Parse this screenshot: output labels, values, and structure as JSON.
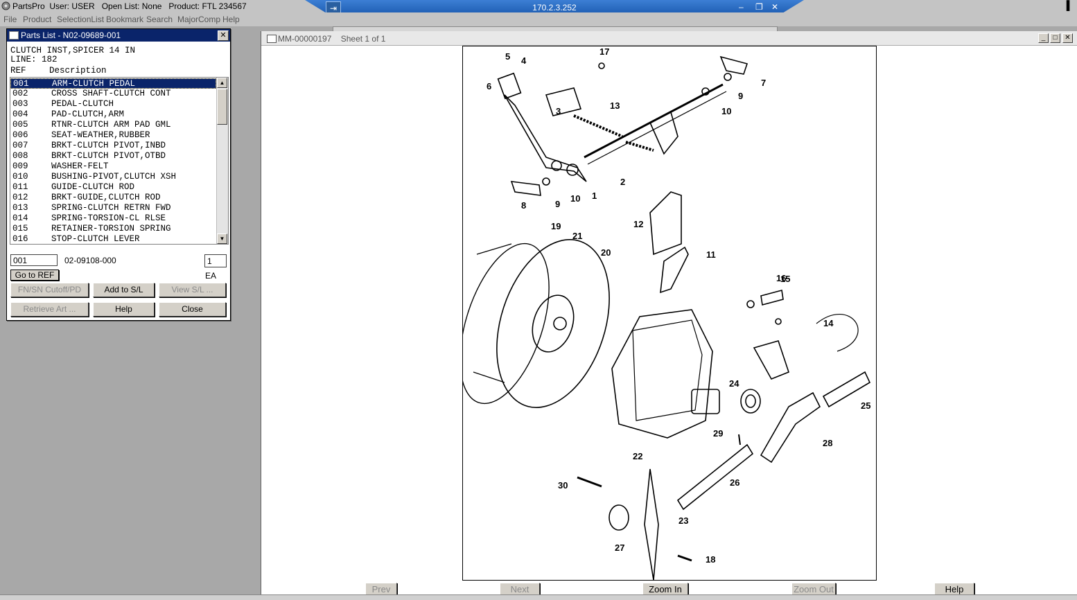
{
  "app": {
    "title": "PartsPro  User: USER   Open List: None   Product: FTL 234567",
    "remote_ip": "170.2.3.252"
  },
  "menu": [
    "File",
    "Product",
    "SelectionList",
    "Bookmark",
    "Search",
    "MajorComp",
    "Help"
  ],
  "parts_dialog": {
    "title": "Parts List - N02-09689-001",
    "description": "CLUTCH INST,SPICER 14 IN",
    "line": "LINE:  182",
    "col_ref": "REF",
    "col_desc": "Description",
    "rows": [
      {
        "ref": "001",
        "desc": "ARM-CLUTCH PEDAL",
        "selected": true
      },
      {
        "ref": "002",
        "desc": "CROSS SHAFT-CLUTCH CONT"
      },
      {
        "ref": "003",
        "desc": "PEDAL-CLUTCH"
      },
      {
        "ref": "004",
        "desc": "PAD-CLUTCH,ARM"
      },
      {
        "ref": "005",
        "desc": "RTNR-CLUTCH ARM PAD GML"
      },
      {
        "ref": "006",
        "desc": "SEAT-WEATHER,RUBBER"
      },
      {
        "ref": "007",
        "desc": "BRKT-CLUTCH PIVOT,INBD"
      },
      {
        "ref": "008",
        "desc": "BRKT-CLUTCH PIVOT,OTBD"
      },
      {
        "ref": "009",
        "desc": "WASHER-FELT"
      },
      {
        "ref": "010",
        "desc": "BUSHING-PIVOT,CLUTCH XSH"
      },
      {
        "ref": "011",
        "desc": "GUIDE-CLUTCH ROD"
      },
      {
        "ref": "012",
        "desc": "BRKT-GUIDE,CLUTCH ROD"
      },
      {
        "ref": "013",
        "desc": "SPRING-CLUTCH RETRN FWD"
      },
      {
        "ref": "014",
        "desc": "SPRING-TORSION-CL RLSE"
      },
      {
        "ref": "015",
        "desc": "RETAINER-TORSION SPRING"
      },
      {
        "ref": "016",
        "desc": "STOP-CLUTCH LEVER"
      }
    ],
    "ref_value": "001",
    "part_number": "02-09108-000",
    "qty_value": "1",
    "unit": "EA",
    "buttons": {
      "goto_ref": "Go to REF",
      "fnsn": "FN/SN Cutoff/PD",
      "add_sl": "Add to S/L",
      "view_sl": "View S/L ...",
      "retrieve": "Retrieve Art ...",
      "help": "Help",
      "close": "Close"
    }
  },
  "drawing": {
    "title": "MM-00000197    Sheet 1 of 1",
    "callouts": [
      "1",
      "2",
      "3",
      "4",
      "5",
      "6",
      "7",
      "8",
      "9",
      "9",
      "10",
      "10",
      "11",
      "12",
      "13",
      "14",
      "15",
      "16",
      "17",
      "18",
      "19",
      "20",
      "21",
      "22",
      "23",
      "24",
      "25",
      "26",
      "27",
      "28",
      "29",
      "30"
    ],
    "nav": {
      "prev": "Prev",
      "next": "Next",
      "zoom_in": "Zoom In",
      "zoom_out": "Zoom Out",
      "help": "Help"
    }
  }
}
